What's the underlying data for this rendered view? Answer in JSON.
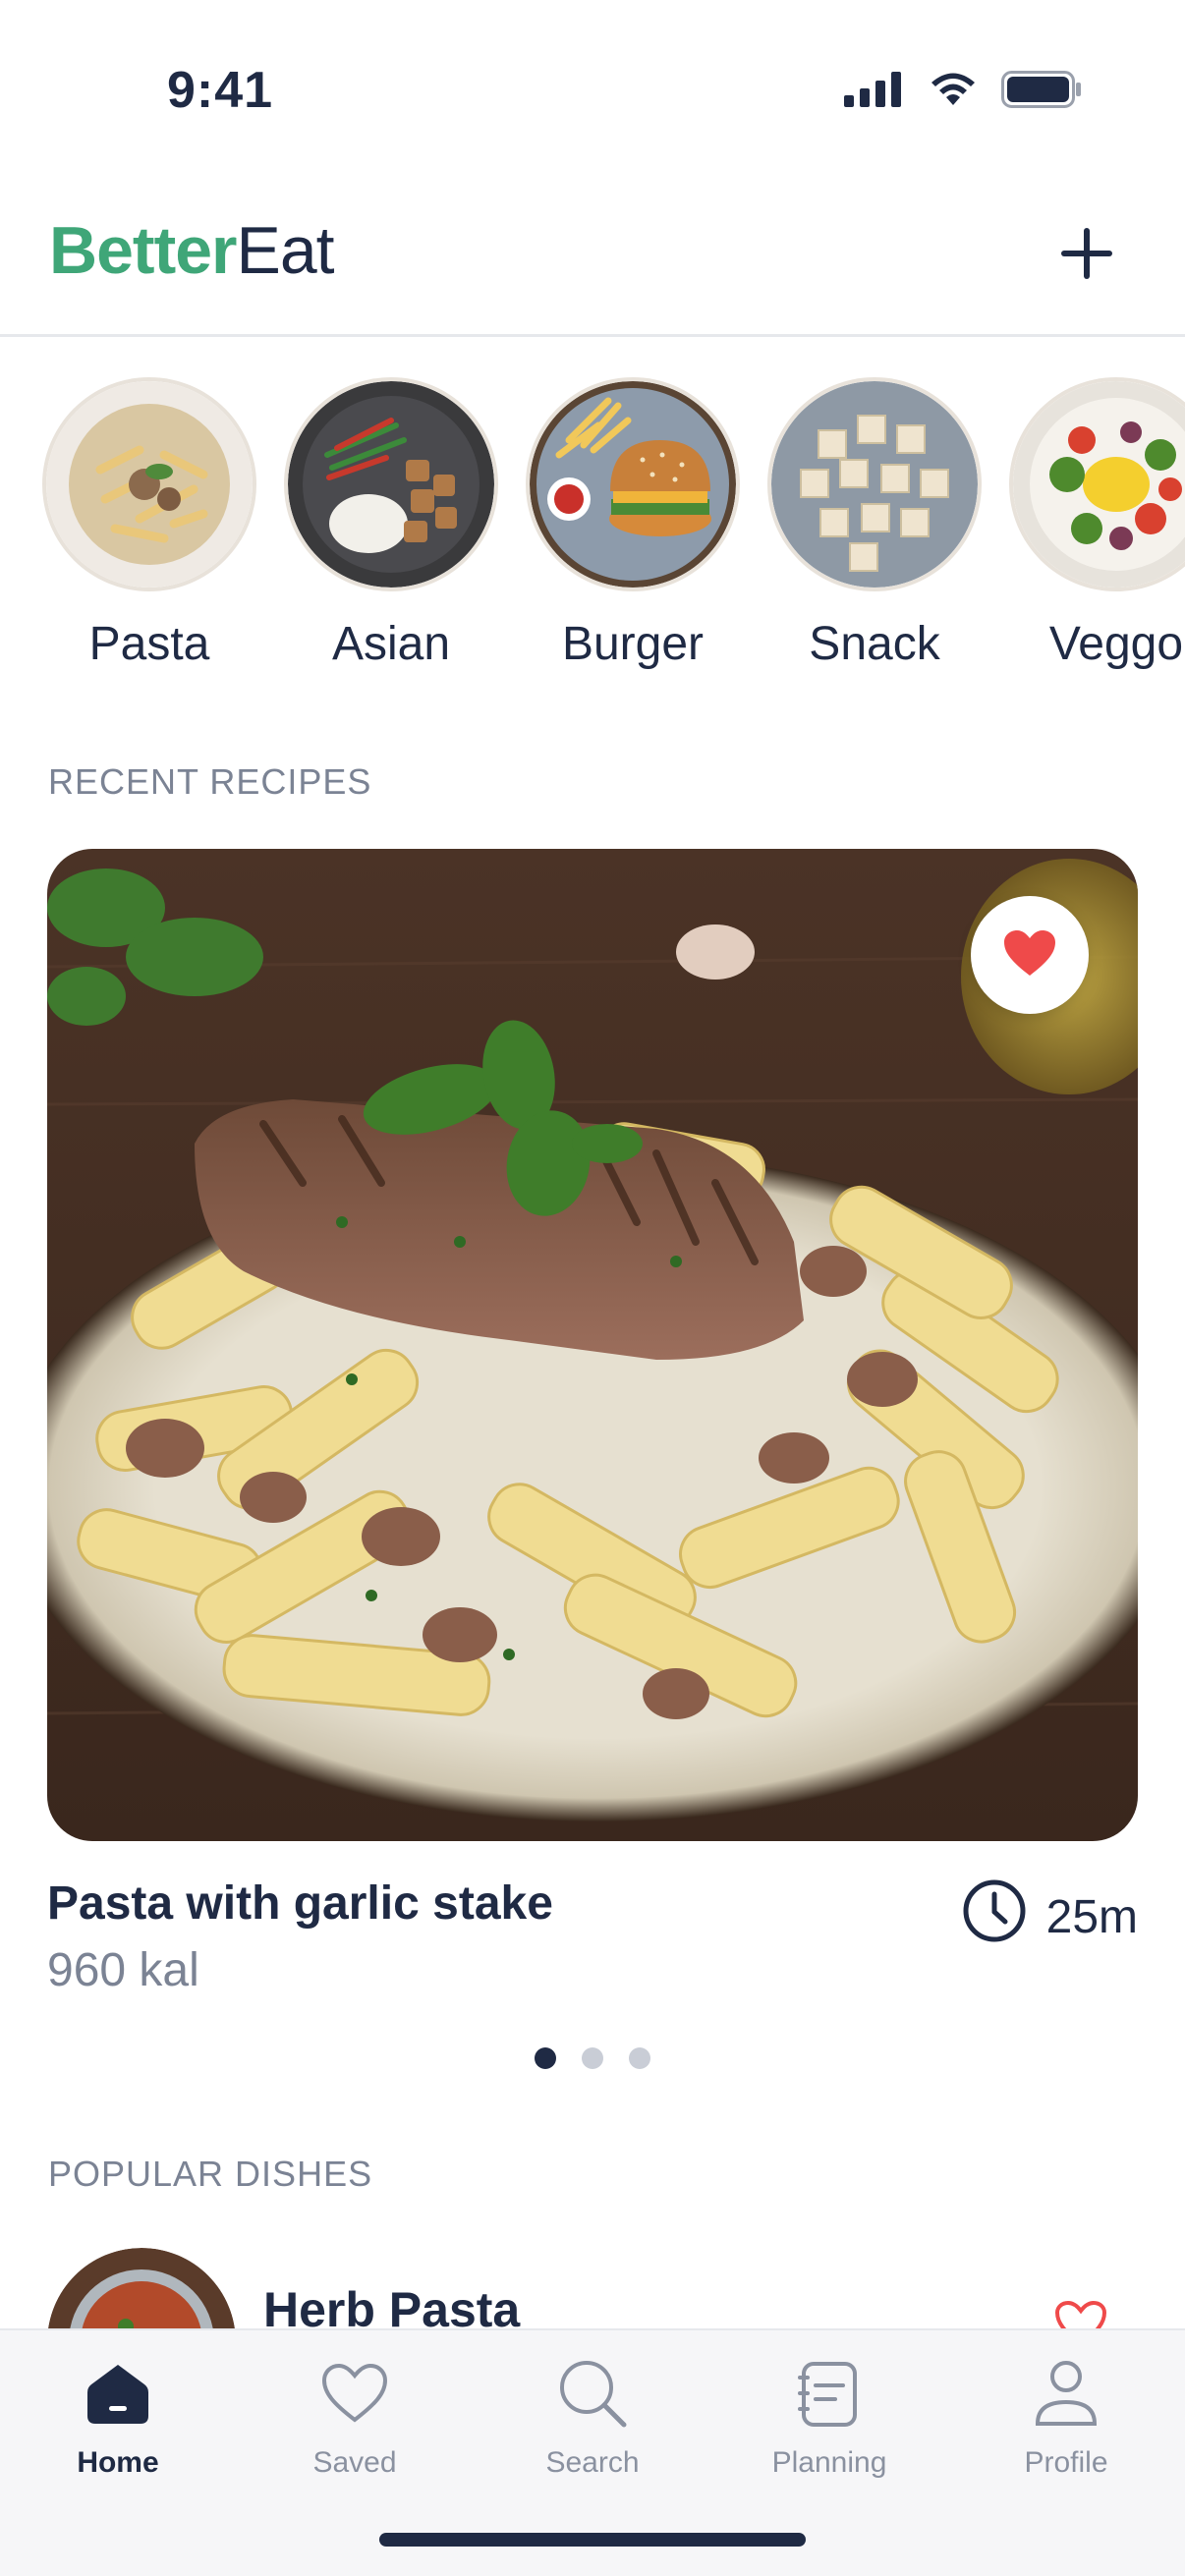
{
  "status_bar": {
    "time": "9:41",
    "icons": [
      "signal-icon",
      "wifi-icon",
      "battery-icon"
    ]
  },
  "header": {
    "logo_part1": "Better",
    "logo_part2": "Eat",
    "add_icon": "plus-icon",
    "brand_color": "#3fa678"
  },
  "categories": [
    {
      "label": "Pasta"
    },
    {
      "label": "Asian"
    },
    {
      "label": "Burger"
    },
    {
      "label": "Snack"
    },
    {
      "label": "Veggo"
    }
  ],
  "recent": {
    "section_title": "RECENT RECIPES",
    "recipe": {
      "title": "Pasta with garlic stake",
      "calories": "960 kal",
      "time": "25m",
      "favorited": true
    },
    "carousel": {
      "pages": 3,
      "active": 1
    }
  },
  "popular": {
    "section_title": "POPULAR DISHES",
    "items": [
      {
        "name": "Herb Pasta"
      }
    ]
  },
  "tab_bar": {
    "tabs": [
      {
        "label": "Home",
        "icon": "home-icon",
        "active": true
      },
      {
        "label": "Saved",
        "icon": "heart-icon",
        "active": false
      },
      {
        "label": "Search",
        "icon": "search-icon",
        "active": false
      },
      {
        "label": "Planning",
        "icon": "notebook-icon",
        "active": false
      },
      {
        "label": "Profile",
        "icon": "user-icon",
        "active": false
      }
    ]
  },
  "colors": {
    "text_primary": "#1f2a44",
    "text_secondary": "#7b8394",
    "accent": "#3fa678",
    "favorite": "#ef4a4a"
  }
}
